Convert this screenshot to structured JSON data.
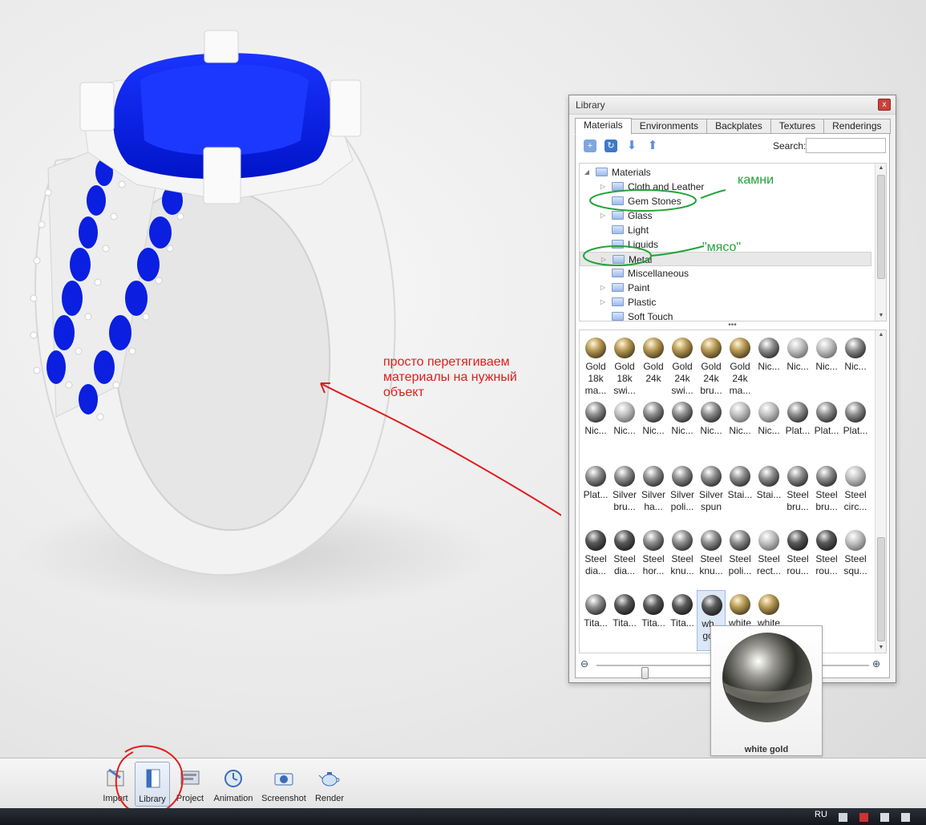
{
  "library": {
    "title": "Library",
    "close_glyph": "x",
    "tabs": [
      {
        "label": "Materials"
      },
      {
        "label": "Environments"
      },
      {
        "label": "Backplates"
      },
      {
        "label": "Textures"
      },
      {
        "label": "Renderings"
      }
    ],
    "search_label": "Search:",
    "search_value": "",
    "tree_root": "Materials",
    "tree": [
      {
        "label": "Cloth and Leather",
        "expandable": true
      },
      {
        "label": "Gem Stones",
        "expandable": false
      },
      {
        "label": "Glass",
        "expandable": true
      },
      {
        "label": "Light",
        "expandable": false
      },
      {
        "label": "Liquids",
        "expandable": false
      },
      {
        "label": "Metal",
        "expandable": true
      },
      {
        "label": "Miscellaneous",
        "expandable": false
      },
      {
        "label": "Paint",
        "expandable": true
      },
      {
        "label": "Plastic",
        "expandable": true
      },
      {
        "label": "Soft Touch",
        "expandable": false
      }
    ],
    "materials": [
      {
        "label": "Gold 18k ma...",
        "tone": "gold"
      },
      {
        "label": "Gold 18k swi...",
        "tone": "gold"
      },
      {
        "label": "Gold 24k",
        "tone": "gold"
      },
      {
        "label": "Gold 24k swi...",
        "tone": "gold"
      },
      {
        "label": "Gold 24k bru...",
        "tone": "gold"
      },
      {
        "label": "Gold 24k ma...",
        "tone": "gold"
      },
      {
        "label": "Nic...",
        "tone": "steel"
      },
      {
        "label": "Nic...",
        "tone": "light"
      },
      {
        "label": "Nic...",
        "tone": "light"
      },
      {
        "label": "Nic...",
        "tone": "steel"
      },
      {
        "label": "Nic...",
        "tone": "steel"
      },
      {
        "label": "Nic...",
        "tone": "light"
      },
      {
        "label": "Nic...",
        "tone": "steel"
      },
      {
        "label": "Nic...",
        "tone": "steel"
      },
      {
        "label": "Nic...",
        "tone": "steel"
      },
      {
        "label": "Nic...",
        "tone": "light"
      },
      {
        "label": "Nic...",
        "tone": "light"
      },
      {
        "label": "Plat...",
        "tone": "steel"
      },
      {
        "label": "Plat...",
        "tone": "steel"
      },
      {
        "label": "Plat...",
        "tone": "steel"
      },
      {
        "label": "Plat...",
        "tone": "steel"
      },
      {
        "label": "Silver bru...",
        "tone": "steel"
      },
      {
        "label": "Silver ha...",
        "tone": "steel"
      },
      {
        "label": "Silver poli...",
        "tone": "steel"
      },
      {
        "label": "Silver spun",
        "tone": "steel"
      },
      {
        "label": "Stai...",
        "tone": "steel"
      },
      {
        "label": "Stai...",
        "tone": "steel"
      },
      {
        "label": "Steel bru...",
        "tone": "steel"
      },
      {
        "label": "Steel bru...",
        "tone": "steel"
      },
      {
        "label": "Steel circ...",
        "tone": "light"
      },
      {
        "label": "Steel dia...",
        "tone": "dark"
      },
      {
        "label": "Steel dia...",
        "tone": "dark"
      },
      {
        "label": "Steel hor...",
        "tone": "steel"
      },
      {
        "label": "Steel knu...",
        "tone": "steel"
      },
      {
        "label": "Steel knu...",
        "tone": "steel"
      },
      {
        "label": "Steel poli...",
        "tone": "steel"
      },
      {
        "label": "Steel rect...",
        "tone": "light"
      },
      {
        "label": "Steel rou...",
        "tone": "dark"
      },
      {
        "label": "Steel rou...",
        "tone": "dark"
      },
      {
        "label": "Steel squ...",
        "tone": "light"
      },
      {
        "label": "Tita...",
        "tone": "steel"
      },
      {
        "label": "Tita...",
        "tone": "dark"
      },
      {
        "label": "Tita...",
        "tone": "dark"
      },
      {
        "label": "Tita...",
        "tone": "dark"
      },
      {
        "label": "wh... go...",
        "tone": "dark"
      },
      {
        "label": "white",
        "tone": "gold"
      },
      {
        "label": "white",
        "tone": "gold"
      }
    ],
    "selected_material_index": 44,
    "zoom_fraction": 0.12
  },
  "drag_preview": {
    "label": "white gold"
  },
  "annotations": {
    "stones": "камни",
    "metal": "\"мясо\"",
    "instruction": "просто перетягиваем материалы на нужный объект"
  },
  "toolbar": {
    "buttons": [
      {
        "label": "Import"
      },
      {
        "label": "Library"
      },
      {
        "label": "Project"
      },
      {
        "label": "Animation"
      },
      {
        "label": "Screenshot"
      },
      {
        "label": "Render"
      }
    ],
    "active": "Library"
  },
  "taskbar": {
    "language": "RU"
  },
  "colors": {
    "gem": "#0a1fe0",
    "metal": "#f3f3f3",
    "annotation_red": "#e11d1d",
    "annotation_green": "#22a33a"
  }
}
